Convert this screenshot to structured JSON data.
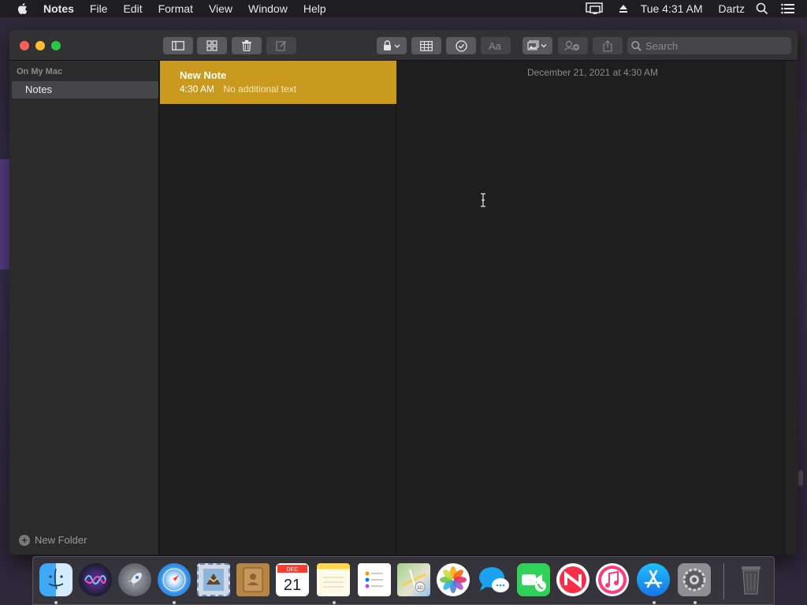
{
  "menubar": {
    "app_name": "Notes",
    "items": [
      "File",
      "Edit",
      "Format",
      "View",
      "Window",
      "Help"
    ],
    "clock": "Tue 4:31 AM",
    "user": "Dartz",
    "icons": [
      "apple-icon",
      "display-mirror-icon",
      "eject-icon",
      "spotlight-search-icon",
      "notification-center-icon"
    ]
  },
  "window": {
    "search_placeholder": "Search",
    "toolbar_icons": [
      "sidebar-toggle-icon",
      "gallery-view-icon",
      "trash-icon",
      "compose-icon",
      "lock-icon",
      "table-icon",
      "checklist-icon",
      "format-text-icon",
      "media-icon",
      "add-people-icon",
      "share-icon"
    ],
    "sidebar": {
      "section": "On My Mac",
      "folder": "Notes",
      "new_folder": "New Folder"
    },
    "notes": [
      {
        "title": "New Note",
        "time": "4:30 AM",
        "preview": "No additional text"
      }
    ],
    "editor": {
      "date": "December 21, 2021 at 4:30 AM"
    },
    "colors": {
      "selected_note": "#c99a1e",
      "window_bg": "#1e1e1e",
      "sidebar_bg": "#2b2b2c"
    }
  },
  "dock": {
    "apps": [
      "Finder",
      "Siri",
      "Launchpad",
      "Safari",
      "Mail",
      "Contacts",
      "Calendar",
      "Notes",
      "Reminders",
      "Maps",
      "Photos",
      "Messages",
      "FaceTime",
      "News",
      "Music",
      "App Store",
      "System Preferences",
      "Trash"
    ],
    "calendar_month": "DEC",
    "calendar_day": "21"
  }
}
